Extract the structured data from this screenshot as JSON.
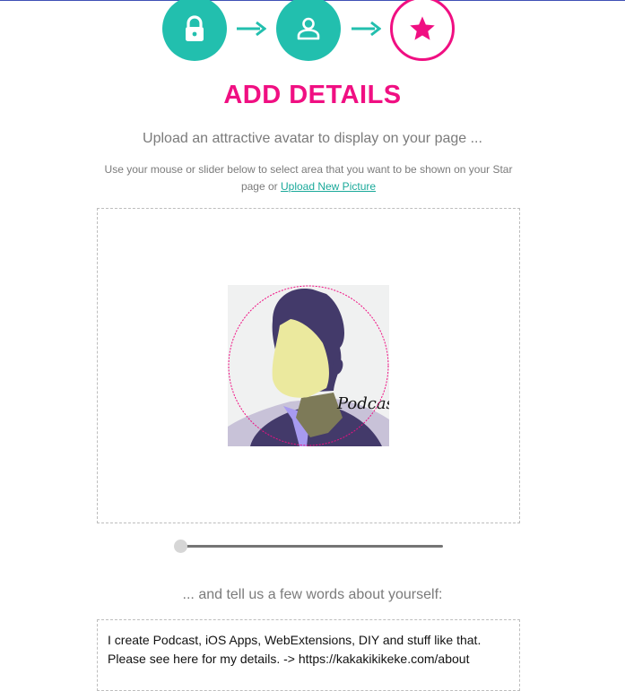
{
  "steps": [
    {
      "icon": "lock-icon",
      "state": "done"
    },
    {
      "icon": "user-icon",
      "state": "done"
    },
    {
      "icon": "star-icon",
      "state": "active"
    }
  ],
  "colors": {
    "accent": "#f00f82",
    "teal": "#22bfae"
  },
  "header": {
    "title": "ADD DETAILS"
  },
  "avatar": {
    "subtitle": "Upload an attractive avatar to display on your page ...",
    "hint": "Use your mouse or slider below to select area that you want to be shown on your Star page or",
    "upload_link": "Upload New Picture",
    "image_text": "Podcast",
    "zoom": 0
  },
  "about": {
    "label": "... and tell us a few words about yourself:",
    "value": "I create Podcast, iOS Apps, WebExtensions, DIY and stuff like that.\nPlease see here for my details. -> https://kakakikikeke.com/about"
  }
}
